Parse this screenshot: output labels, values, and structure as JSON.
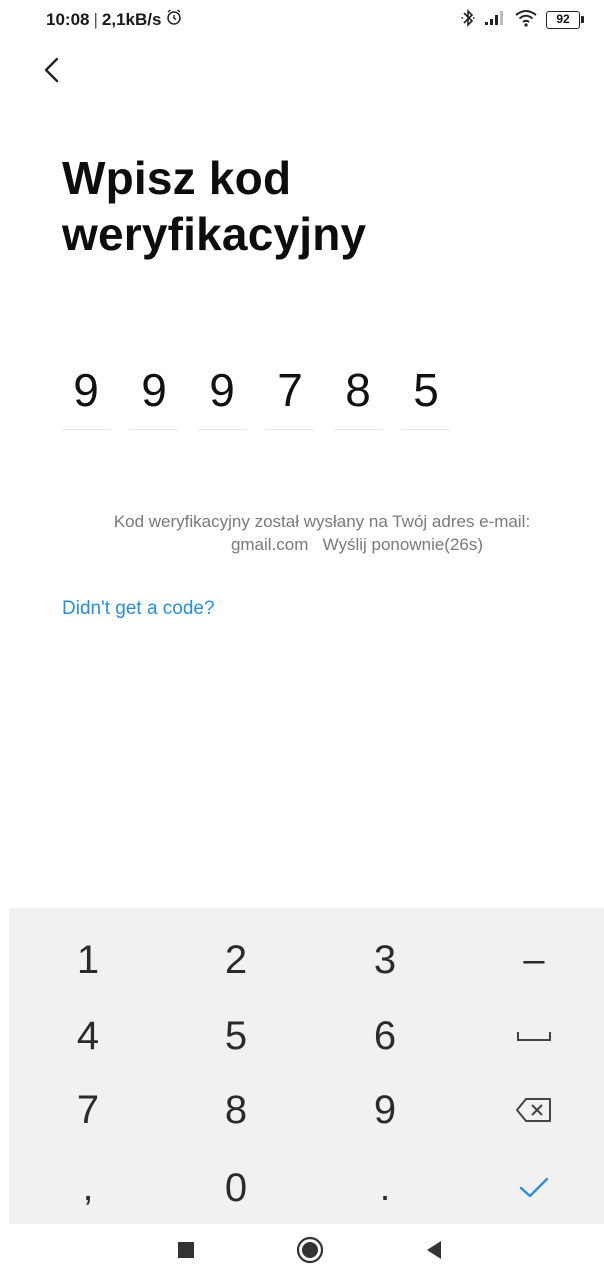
{
  "status_bar": {
    "time": "10:08",
    "separator": "|",
    "network_speed": "2,1kB/s",
    "battery": "92",
    "icons": [
      "alarm-icon",
      "bluetooth-icon",
      "signal-icon",
      "wifi-icon",
      "battery-icon"
    ]
  },
  "header": {
    "back_icon": "chevron-left-icon",
    "title": "Wpisz kod weryfikacyjny"
  },
  "code": {
    "digits": [
      "9",
      "9",
      "9",
      "7",
      "8",
      "5"
    ]
  },
  "info": {
    "line1": "Kod weryfikacyjny został wysłany na Twój adres e-mail:",
    "email": "gmail.com",
    "resend": "Wyślij ponownie(26s)"
  },
  "help_link": "Didn't get a code?",
  "keyboard": {
    "keys": [
      [
        "1",
        "2",
        "3",
        "–"
      ],
      [
        "4",
        "5",
        "6",
        "space-icon"
      ],
      [
        "7",
        "8",
        "9",
        "backspace-icon"
      ],
      [
        ",",
        "0",
        ".",
        "check-icon"
      ]
    ],
    "accent": "#2a8fd6",
    "background": "#f1f1f1"
  },
  "nav_bar": {
    "icons": [
      "square-recents-icon",
      "circle-home-icon",
      "triangle-back-icon"
    ]
  }
}
